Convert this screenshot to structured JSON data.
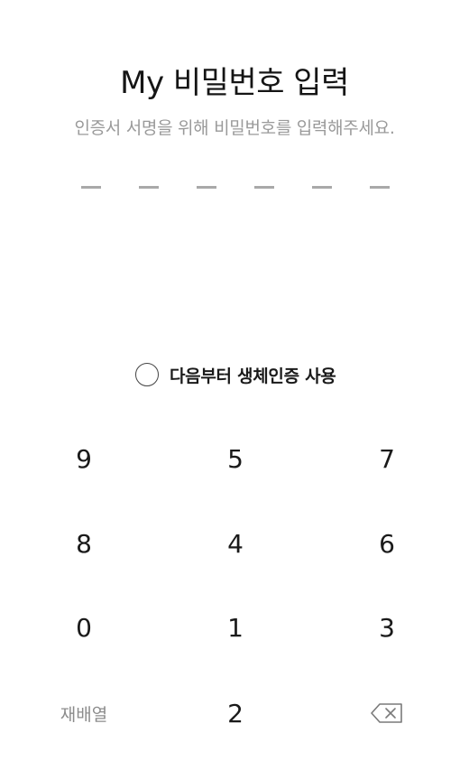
{
  "header": {
    "title": "My 비밀번호 입력",
    "subtitle": "인증서 서명을 위해 비밀번호를 입력해주세요."
  },
  "pin": {
    "length": 6,
    "entered": 0
  },
  "biometric": {
    "label": "다음부터 생체인증 사용",
    "checked": false
  },
  "keypad": {
    "rows": [
      [
        "9",
        "5",
        "7"
      ],
      [
        "8",
        "4",
        "6"
      ],
      [
        "0",
        "1",
        "3"
      ]
    ],
    "shuffle_label": "재배열",
    "bottom_digit": "2",
    "backspace_icon": "backspace-icon"
  },
  "colors": {
    "title": "#151515",
    "subtitle": "#9a9a9a",
    "pin_dash": "#a9a9a9",
    "shuffle": "#8c8c8c"
  }
}
